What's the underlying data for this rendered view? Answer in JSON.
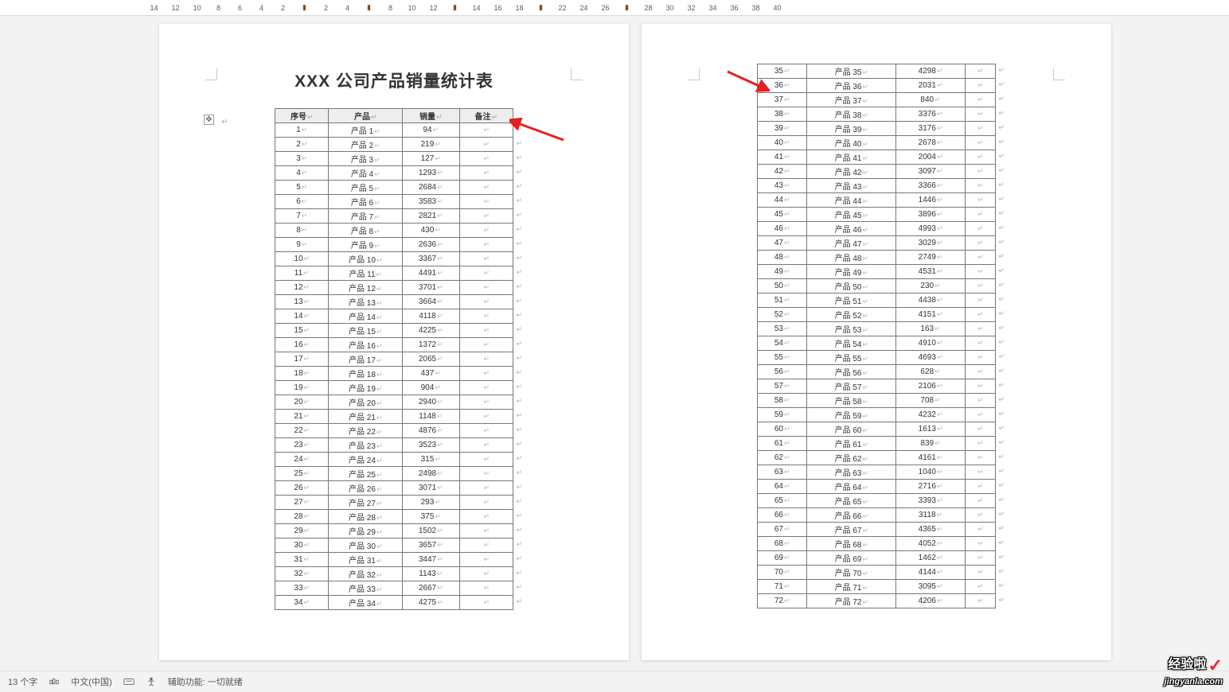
{
  "ruler": {
    "nums": [
      14,
      12,
      10,
      8,
      6,
      4,
      2,
      "",
      2,
      4,
      "",
      8,
      10,
      12,
      "",
      14,
      16,
      18,
      "",
      22,
      24,
      26,
      "",
      28,
      30,
      32,
      34,
      36,
      38,
      40
    ]
  },
  "doc": {
    "title": "XXX 公司产品销量统计表",
    "headers": [
      "序号",
      "产品",
      "销量",
      "备注"
    ],
    "rows_p1": [
      {
        "n": "1",
        "p": "产品 1",
        "v": "94"
      },
      {
        "n": "2",
        "p": "产品 2",
        "v": "219"
      },
      {
        "n": "3",
        "p": "产品 3",
        "v": "127"
      },
      {
        "n": "4",
        "p": "产品 4",
        "v": "1293"
      },
      {
        "n": "5",
        "p": "产品 5",
        "v": "2684"
      },
      {
        "n": "6",
        "p": "产品 6",
        "v": "3583"
      },
      {
        "n": "7",
        "p": "产品 7",
        "v": "2821"
      },
      {
        "n": "8",
        "p": "产品 8",
        "v": "430"
      },
      {
        "n": "9",
        "p": "产品 9",
        "v": "2636"
      },
      {
        "n": "10",
        "p": "产品 10",
        "v": "3367"
      },
      {
        "n": "11",
        "p": "产品 11",
        "v": "4491"
      },
      {
        "n": "12",
        "p": "产品 12",
        "v": "3701"
      },
      {
        "n": "13",
        "p": "产品 13",
        "v": "3664"
      },
      {
        "n": "14",
        "p": "产品 14",
        "v": "4118"
      },
      {
        "n": "15",
        "p": "产品 15",
        "v": "4225"
      },
      {
        "n": "16",
        "p": "产品 16",
        "v": "1372"
      },
      {
        "n": "17",
        "p": "产品 17",
        "v": "2065"
      },
      {
        "n": "18",
        "p": "产品 18",
        "v": "437"
      },
      {
        "n": "19",
        "p": "产品 19",
        "v": "904"
      },
      {
        "n": "20",
        "p": "产品 20",
        "v": "2940"
      },
      {
        "n": "21",
        "p": "产品 21",
        "v": "1148"
      },
      {
        "n": "22",
        "p": "产品 22",
        "v": "4876"
      },
      {
        "n": "23",
        "p": "产品 23",
        "v": "3523"
      },
      {
        "n": "24",
        "p": "产品 24",
        "v": "315"
      },
      {
        "n": "25",
        "p": "产品 25",
        "v": "2498"
      },
      {
        "n": "26",
        "p": "产品 26",
        "v": "3071"
      },
      {
        "n": "27",
        "p": "产品 27",
        "v": "293"
      },
      {
        "n": "28",
        "p": "产品 28",
        "v": "375"
      },
      {
        "n": "29",
        "p": "产品 29",
        "v": "1502"
      },
      {
        "n": "30",
        "p": "产品 30",
        "v": "3657"
      },
      {
        "n": "31",
        "p": "产品 31",
        "v": "3447"
      },
      {
        "n": "32",
        "p": "产品 32",
        "v": "1143"
      },
      {
        "n": "33",
        "p": "产品 33",
        "v": "2667"
      },
      {
        "n": "34",
        "p": "产品 34",
        "v": "4275"
      }
    ],
    "rows_p2": [
      {
        "n": "35",
        "p": "产品 35",
        "v": "4298"
      },
      {
        "n": "36",
        "p": "产品 36",
        "v": "2031"
      },
      {
        "n": "37",
        "p": "产品 37",
        "v": "840"
      },
      {
        "n": "38",
        "p": "产品 38",
        "v": "3376"
      },
      {
        "n": "39",
        "p": "产品 39",
        "v": "3176"
      },
      {
        "n": "40",
        "p": "产品 40",
        "v": "2678"
      },
      {
        "n": "41",
        "p": "产品 41",
        "v": "2004"
      },
      {
        "n": "42",
        "p": "产品 42",
        "v": "3097"
      },
      {
        "n": "43",
        "p": "产品 43",
        "v": "3366"
      },
      {
        "n": "44",
        "p": "产品 44",
        "v": "1446"
      },
      {
        "n": "45",
        "p": "产品 45",
        "v": "3896"
      },
      {
        "n": "46",
        "p": "产品 46",
        "v": "4993"
      },
      {
        "n": "47",
        "p": "产品 47",
        "v": "3029"
      },
      {
        "n": "48",
        "p": "产品 48",
        "v": "2749"
      },
      {
        "n": "49",
        "p": "产品 49",
        "v": "4531"
      },
      {
        "n": "50",
        "p": "产品 50",
        "v": "230"
      },
      {
        "n": "51",
        "p": "产品 51",
        "v": "4438"
      },
      {
        "n": "52",
        "p": "产品 52",
        "v": "4151"
      },
      {
        "n": "53",
        "p": "产品 53",
        "v": "163"
      },
      {
        "n": "54",
        "p": "产品 54",
        "v": "4910"
      },
      {
        "n": "55",
        "p": "产品 55",
        "v": "4693"
      },
      {
        "n": "56",
        "p": "产品 56",
        "v": "628"
      },
      {
        "n": "57",
        "p": "产品 57",
        "v": "2106"
      },
      {
        "n": "58",
        "p": "产品 58",
        "v": "708"
      },
      {
        "n": "59",
        "p": "产品 59",
        "v": "4232"
      },
      {
        "n": "60",
        "p": "产品 60",
        "v": "1613"
      },
      {
        "n": "61",
        "p": "产品 61",
        "v": "839"
      },
      {
        "n": "62",
        "p": "产品 62",
        "v": "4161"
      },
      {
        "n": "63",
        "p": "产品 63",
        "v": "1040"
      },
      {
        "n": "64",
        "p": "产品 64",
        "v": "2716"
      },
      {
        "n": "65",
        "p": "产品 65",
        "v": "3393"
      },
      {
        "n": "66",
        "p": "产品 66",
        "v": "3118"
      },
      {
        "n": "67",
        "p": "产品 67",
        "v": "4365"
      },
      {
        "n": "68",
        "p": "产品 68",
        "v": "4052"
      },
      {
        "n": "69",
        "p": "产品 69",
        "v": "1462"
      },
      {
        "n": "70",
        "p": "产品 70",
        "v": "4144"
      },
      {
        "n": "71",
        "p": "产品 71",
        "v": "3095"
      },
      {
        "n": "72",
        "p": "产品 72",
        "v": "4206"
      }
    ]
  },
  "status": {
    "words": "13 个字",
    "lang": "中文(中国)",
    "a11y": "辅助功能: 一切就绪"
  },
  "logo": {
    "t1": "经验啦",
    "t2": "jingyanla.com"
  }
}
